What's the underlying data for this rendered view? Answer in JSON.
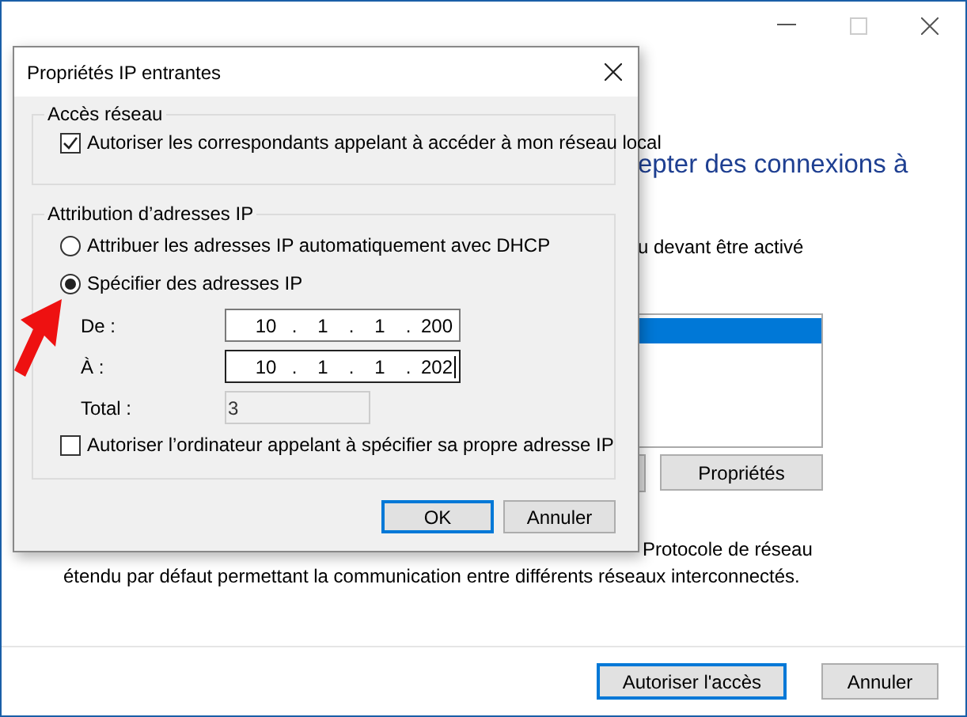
{
  "main_window": {
    "heading": "epter des connexions à",
    "note": "u devant être activé",
    "list_rows": [
      {
        "selected": true
      }
    ],
    "properties_button": "Propriétés",
    "description": [
      "Protocole de réseau",
      "étendu par défaut permettant la communication entre différents réseaux interconnectés."
    ],
    "buttons": [
      {
        "label": "Autoriser l'accès",
        "default": true
      },
      {
        "label": "Annuler",
        "default": false
      }
    ]
  },
  "dialog": {
    "title": "Propriétés IP entrantes",
    "network_access": {
      "title": "Accès réseau",
      "checkbox": {
        "label": "Autoriser les correspondants appelant à accéder à mon réseau local",
        "checked": true
      }
    },
    "ip_assignment": {
      "title": "Attribution d’adresses IP",
      "radios": [
        {
          "label": "Attribuer les adresses IP automatiquement avec DHCP",
          "selected": false
        },
        {
          "label": "Spécifier des adresses IP",
          "selected": true
        }
      ],
      "ranges": [
        {
          "label": "De :",
          "octets": [
            "10",
            "1",
            "1",
            "200"
          ],
          "separator": ".",
          "focused": false
        },
        {
          "label": "À :",
          "octets": [
            "10",
            "1",
            "1",
            "202"
          ],
          "separator": ".",
          "focused": true
        }
      ],
      "total": {
        "label": "Total :",
        "value": "3",
        "disabled": true
      },
      "checkbox": {
        "label": "Autoriser l’ordinateur appelant à spécifier sa propre adresse IP",
        "checked": false
      }
    },
    "buttons": [
      {
        "label": "OK",
        "default": true
      },
      {
        "label": "Annuler",
        "default": false
      }
    ]
  }
}
